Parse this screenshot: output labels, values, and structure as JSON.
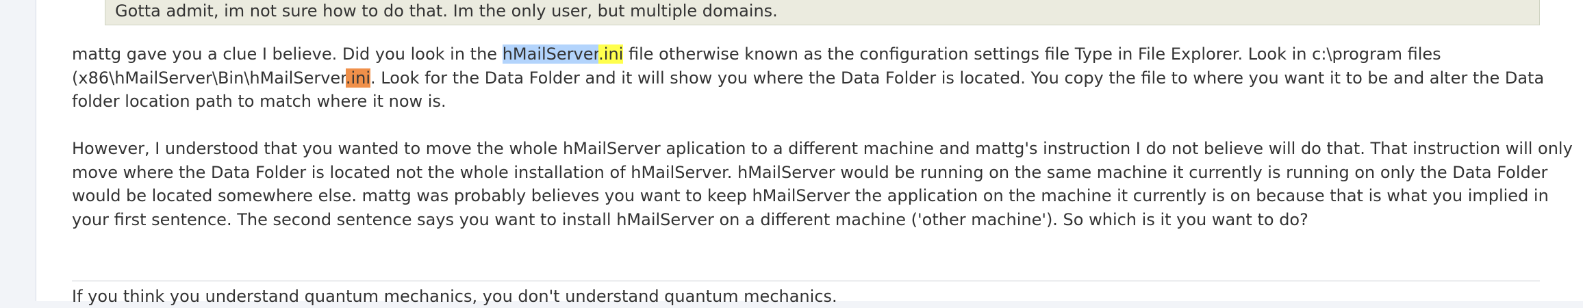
{
  "quote": {
    "text": "Gotta admit, im not sure how to do that. Im the only user, but multiple domains."
  },
  "reply": {
    "paragraph1": {
      "before": "mattg gave you a clue I believe. Did you look in the ",
      "term_name": "hMailServer",
      "term_ext": ".ini",
      "middle": " file otherwise known as the configuration settings file Type in File Explorer. Look in c:\\program files (x86\\hMailServer\\Bin\\hMailServer",
      "path_ext": ".ini",
      "after": ". Look for the Data Folder and it will show you where the Data Folder is located. You copy the file to where you want it to be and alter the Data folder location path to match where it now is."
    },
    "paragraph2": "However, I understood that you wanted to move the whole hMailServer aplication to a different machine and mattg's instruction I do not believe will do that. That instruction will only move where the Data Folder is located not the whole installation of hMailServer. hMailServer would be running on the same machine it currently is running on only the Data Folder would be located somewhere else. mattg was probably believes you want to keep hMailServer the application on the machine it currently is on because that is what you implied in your first sentence. The second sentence says you want to install hMailServer on a different machine ('other machine'). So which is it you want to do?"
  },
  "signature": {
    "text": "If you think you understand quantum mechanics, you don't understand quantum mechanics."
  },
  "colors": {
    "selection_highlight": "#b3d4fc",
    "search_match": "#ffff4d",
    "current_search_match": "#f0904a",
    "quote_background": "#ebebdf"
  }
}
